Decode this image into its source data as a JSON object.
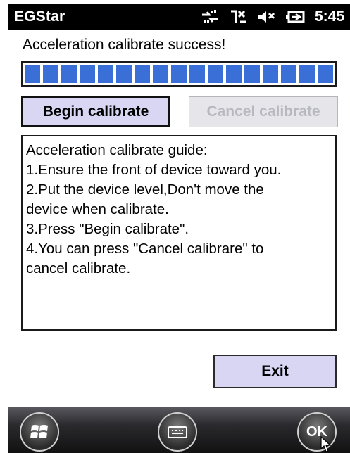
{
  "statusbar": {
    "title": "EGStar",
    "time": "5:45",
    "icons": [
      "connectivity-icon",
      "signal-off-icon",
      "volume-muted-icon",
      "battery-charging-icon"
    ]
  },
  "main": {
    "message": "Acceleration calibrate success!",
    "progress_fraction": 1.0,
    "progress_segments": 17,
    "begin_button": "Begin calibrate",
    "cancel_button": "Cancel calibrate",
    "guide_lines": [
      "Acceleration calibrate guide:",
      "1.Ensure the front of device toward you.",
      "2.Put the device level,Don't move the",
      "device when calibrate.",
      "3.Press \"Begin calibrate\".",
      "4.You can press \"Cancel calibrare\" to",
      "cancel calibrate."
    ],
    "exit_button": "Exit"
  },
  "taskbar": {
    "start_icon": "windows-start-icon",
    "keyboard_icon": "keyboard-icon",
    "ok_label": "OK"
  },
  "colors": {
    "progress_fill": "#3a6fd8",
    "button_fill": "#d9d6f4",
    "disabled_text": "#b8b8c0"
  }
}
